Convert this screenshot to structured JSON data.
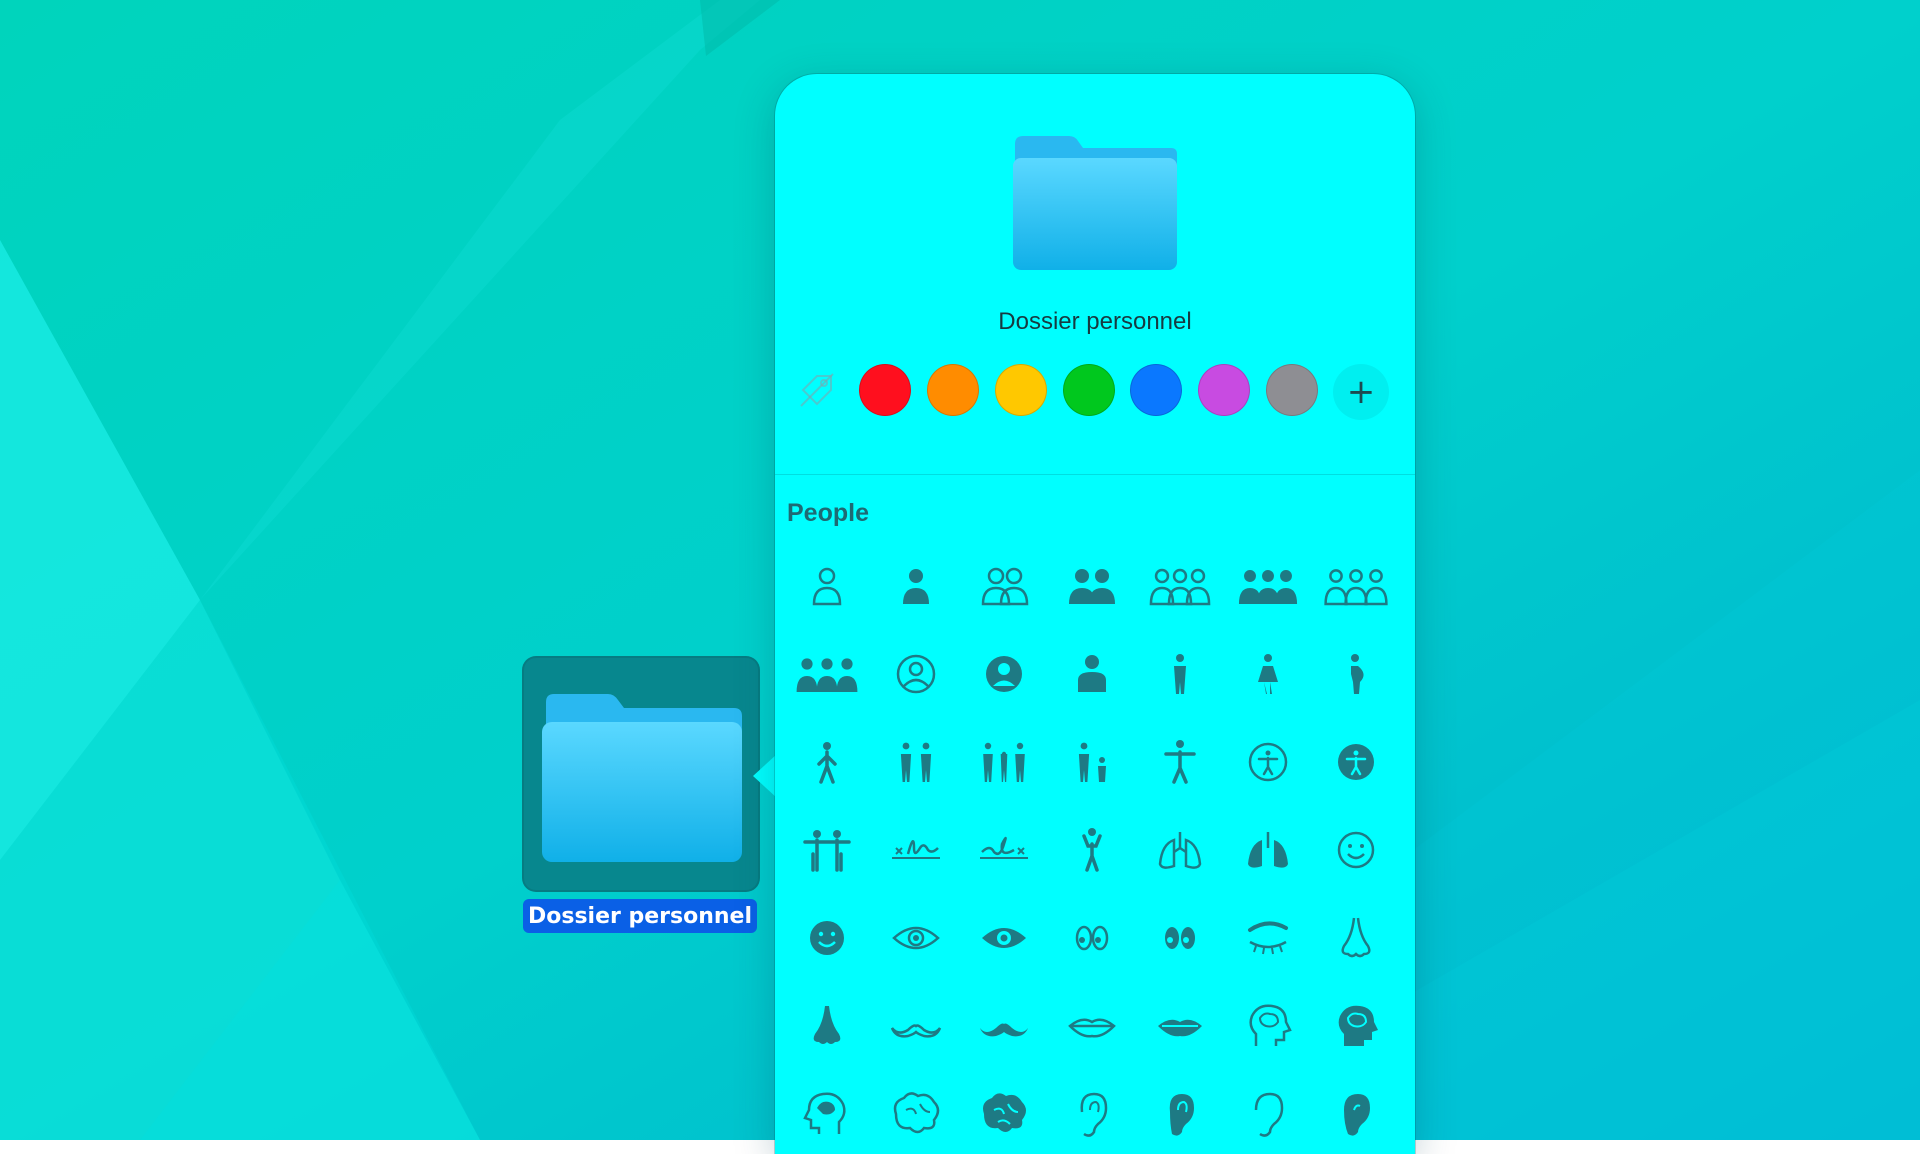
{
  "wallpaper": {
    "colors": [
      "#00d8c0",
      "#00e8e0",
      "#00c0d8"
    ]
  },
  "desktop_item": {
    "label": "Dossier personnel",
    "icon": "folder-icon"
  },
  "popover": {
    "folder_name": "Dossier personnel",
    "preview_icon": "folder-icon",
    "colors": [
      {
        "name": "no-color",
        "icon": "no-tag-icon"
      },
      {
        "name": "red",
        "hex": "#ff0f1e"
      },
      {
        "name": "orange",
        "hex": "#ff8c00"
      },
      {
        "name": "yellow",
        "hex": "#ffc800"
      },
      {
        "name": "green",
        "hex": "#00c81e"
      },
      {
        "name": "blue",
        "hex": "#0a78ff"
      },
      {
        "name": "purple",
        "hex": "#c84be1"
      },
      {
        "name": "gray",
        "hex": "#8e8e93"
      },
      {
        "name": "add-color",
        "label": "+"
      }
    ],
    "section_title": "People",
    "symbols": [
      "person-icon",
      "person-fill-icon",
      "person-2-icon",
      "person-2-fill-icon",
      "person-3-icon",
      "person-3-fill-icon",
      "person-3-sequence-icon",
      "person-3-sequence-fill-icon",
      "person-circle-icon",
      "person-circle-fill-icon",
      "person-bust-icon",
      "figure-stand-icon",
      "figure-dress-icon",
      "figure-pregnant-icon",
      "figure-walk-icon",
      "figure-2-icon",
      "figure-family-icon",
      "figure-and-child-icon",
      "figure-arms-open-icon",
      "accessibility-icon",
      "accessibility-fill-icon",
      "figure-2-arms-open-icon",
      "signature-icon",
      "signature-2-icon",
      "figure-wave-icon",
      "lungs-icon",
      "lungs-fill-icon",
      "face-smiling-icon",
      "face-smiling-fill-icon",
      "eye-icon",
      "eye-fill-icon",
      "eyes-icon",
      "eyes-inverse-icon",
      "eyebrow-icon",
      "nose-icon",
      "nose-fill-icon",
      "mustache-icon",
      "mustache-fill-icon",
      "mouth-icon",
      "mouth-fill-icon",
      "brain-head-profile-icon",
      "brain-head-profile-fill-icon",
      "brain-head-profile-alt-icon",
      "brain-icon",
      "brain-fill-icon",
      "ear-icon",
      "ear-fill-icon",
      "ear-2-icon",
      "ear-2-fill-icon"
    ],
    "icon_color": "#1e7a84"
  }
}
